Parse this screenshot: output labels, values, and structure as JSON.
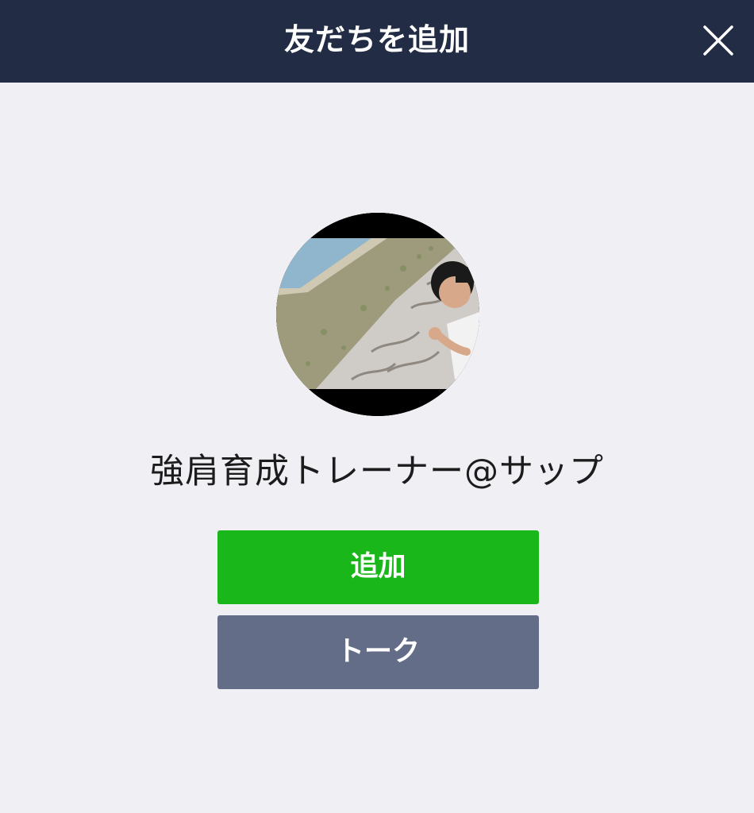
{
  "header": {
    "title": "友だちを追加",
    "close_icon": "close-icon"
  },
  "profile": {
    "name": "強肩育成トレーナー@サップ",
    "avatar_icon": "avatar-photo"
  },
  "actions": {
    "add_label": "追加",
    "talk_label": "トーク"
  },
  "colors": {
    "header_bg": "#222c44",
    "page_bg": "#f0eff4",
    "add_button": "#1ab71b",
    "talk_button": "#646d88"
  }
}
